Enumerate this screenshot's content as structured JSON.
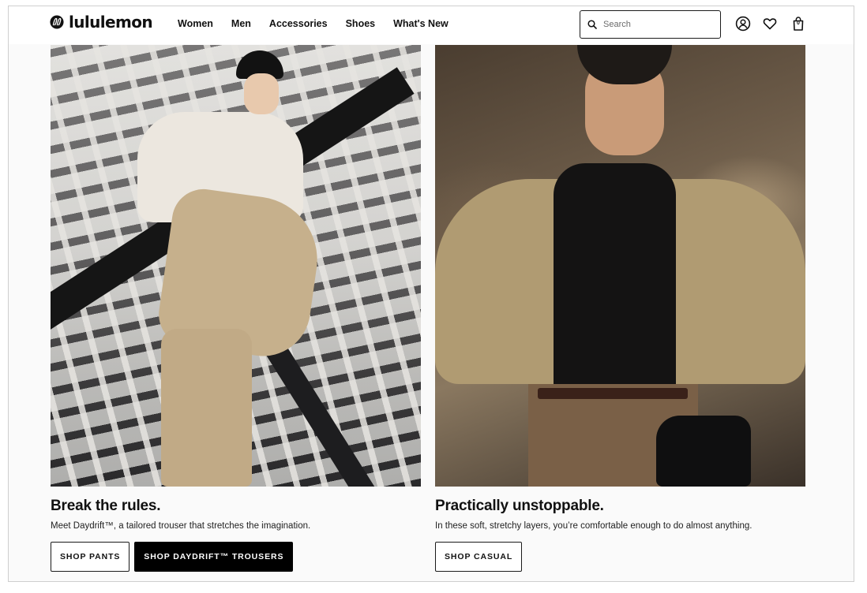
{
  "header": {
    "logo_text": "lululemon",
    "nav": [
      "Women",
      "Men",
      "Accessories",
      "Shoes",
      "What's New"
    ],
    "search": {
      "placeholder": "Search",
      "value": ""
    },
    "icons": [
      "search-icon",
      "account-icon",
      "heart-icon",
      "bag-icon"
    ],
    "bag_count": "0"
  },
  "promos": [
    {
      "title": "Break the rules.",
      "description": "Meet Daydrift™, a tailored trouser that stretches the imagination.",
      "buttons": [
        {
          "label": "SHOP PANTS",
          "style": "outline"
        },
        {
          "label": "SHOP DAYDRIFT™ TROUSERS",
          "style": "solid"
        }
      ]
    },
    {
      "title": "Practically unstoppable.",
      "description": "In these soft, stretchy layers, you’re comfortable enough to do almost anything.",
      "buttons": [
        {
          "label": "SHOP CASUAL",
          "style": "outline"
        }
      ]
    }
  ],
  "colors": {
    "text": "#111111",
    "button_solid": "#000000",
    "page_bg": "#fafafa"
  }
}
